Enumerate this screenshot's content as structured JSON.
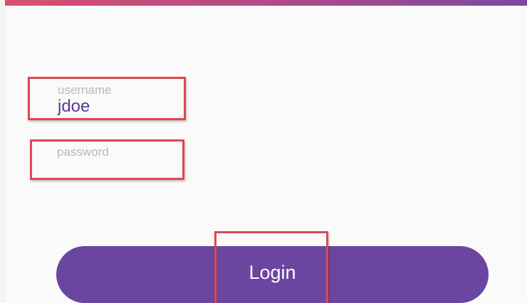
{
  "header": {
    "accent_start": "#d8506e",
    "accent_end": "#7b4aa2"
  },
  "form": {
    "username": {
      "label": "username",
      "value": "jdoe"
    },
    "password": {
      "label": "password",
      "value": ""
    },
    "login_label": "Login"
  },
  "colors": {
    "primary": "#6b46a0",
    "value_text": "#5b3b9a",
    "label_text": "#b9b9bd",
    "highlight": "#e0474c"
  }
}
